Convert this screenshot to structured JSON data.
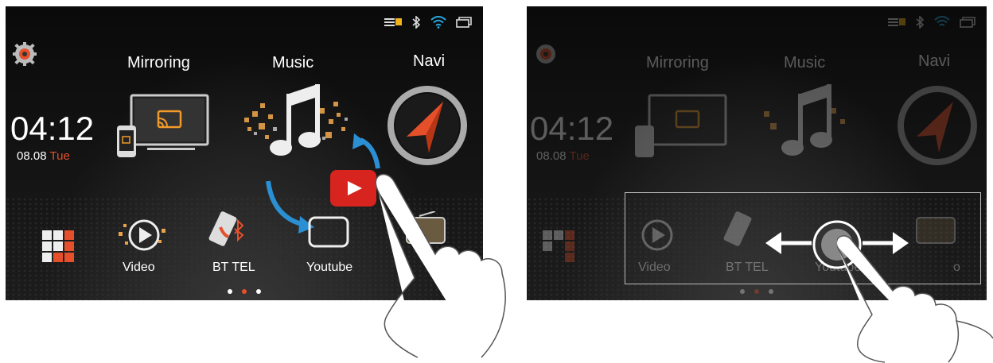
{
  "status_bar": {
    "icons": [
      "menu-icon",
      "bluetooth-icon",
      "wifi-icon",
      "window-icon"
    ]
  },
  "clock": {
    "time": "04:12",
    "date": "08.08",
    "day": "Tue"
  },
  "apps_top": {
    "mirroring": "Mirroring",
    "music": "Music",
    "navi": "Navi"
  },
  "apps_bottom": {
    "video": "Video",
    "bt_tel": "BT TEL",
    "youtube": "Youtube"
  },
  "right_labels": {
    "radio_partial": "o"
  },
  "pagination": {
    "count": 3,
    "active_index": 1
  },
  "colors": {
    "accent": "#e5502b",
    "youtube_red": "#d8241e",
    "arrow_blue": "#2b8fd3"
  }
}
